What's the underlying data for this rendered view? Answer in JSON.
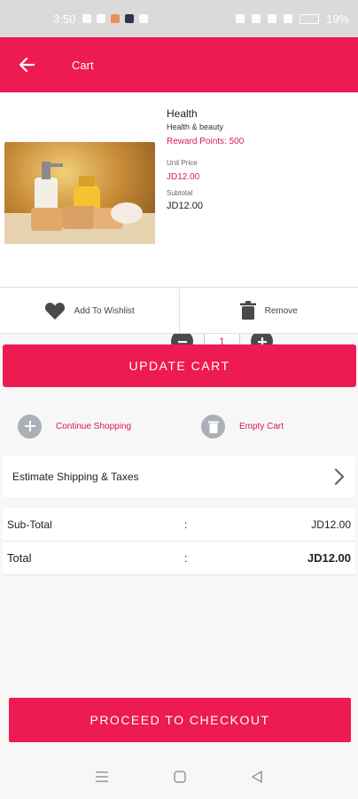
{
  "status_bar": {
    "time": "3:50",
    "battery": "19%"
  },
  "app_bar": {
    "title": "Cart",
    "back_icon": "arrow-left-icon"
  },
  "product": {
    "name": "Health",
    "category": "Health & beauty",
    "reward_points": "Reward Points: 500",
    "unit_price_label": "Unit Price",
    "unit_price": "JD12.00",
    "subtotal_label": "Subtotal",
    "subtotal": "JD12.00",
    "quantity": "1"
  },
  "actions": {
    "wishlist": "Add To Wishlist",
    "remove": "Remove"
  },
  "update_cart": "UPDATE CART",
  "links": {
    "continue": "Continue Shopping",
    "empty": "Empty Cart"
  },
  "shipping": "Estimate Shipping & Taxes",
  "totals": [
    {
      "label": "Sub-Total",
      "sep": ":",
      "value": "JD12.00"
    },
    {
      "label": "Total",
      "sep": ":",
      "value": "JD12.00"
    }
  ],
  "checkout": "PROCEED TO CHECKOUT",
  "colors": {
    "accent": "#ee1a52",
    "accent_text": "#d81b50"
  }
}
